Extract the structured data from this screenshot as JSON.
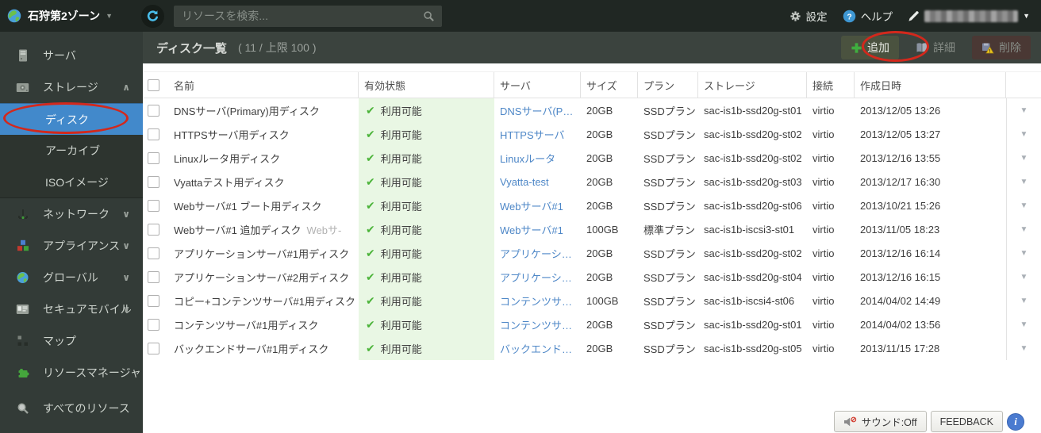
{
  "topbar": {
    "zone_label": "石狩第2ゾーン",
    "search_placeholder": "リソースを検索...",
    "settings_label": "設定",
    "help_label": "ヘルプ"
  },
  "sidebar": {
    "items": [
      {
        "id": "server",
        "label": "サーバ",
        "icon": "server-icon"
      },
      {
        "id": "storage",
        "label": "ストレージ",
        "icon": "storage-icon",
        "chevron": "up"
      },
      {
        "id": "disk",
        "label": "ディスク",
        "submenu": true,
        "selected": true
      },
      {
        "id": "archive",
        "label": "アーカイブ",
        "submenu": true
      },
      {
        "id": "iso",
        "label": "ISOイメージ",
        "submenu": true
      },
      {
        "id": "network",
        "label": "ネットワーク",
        "icon": "network-icon",
        "chevron": "down"
      },
      {
        "id": "appliance",
        "label": "アプライアンス",
        "icon": "appliance-icon",
        "chevron": "down"
      },
      {
        "id": "global",
        "label": "グローバル",
        "icon": "globe-icon",
        "chevron": "down"
      },
      {
        "id": "securemobile",
        "label": "セキュアモバイル",
        "icon": "securemobile-icon",
        "chevron": "down"
      },
      {
        "id": "map",
        "label": "マップ",
        "icon": "map-icon"
      },
      {
        "id": "resourcemanager",
        "label": "リソースマネージャ",
        "icon": "resourcemanager-icon"
      },
      {
        "id": "allresources",
        "label": "すべてのリソース",
        "icon": "allresources-icon"
      }
    ]
  },
  "content_header": {
    "title": "ディスク一覧",
    "count": "( 11 / 上限 100 )",
    "add_label": "追加",
    "detail_label": "詳細",
    "delete_label": "削除"
  },
  "table": {
    "headers": {
      "name": "名前",
      "status": "有効状態",
      "server": "サーバ",
      "size": "サイズ",
      "plan": "プラン",
      "storage": "ストレージ",
      "connection": "接続",
      "created": "作成日時"
    },
    "rows": [
      {
        "name": "DNSサーバ(Primary)用ディスク",
        "note": "",
        "status": "利用可能",
        "server": "DNSサーバ(P…",
        "size": "20GB",
        "plan": "SSDプラン",
        "storage": "sac-is1b-ssd20g-st01",
        "connection": "virtio",
        "created": "2013/12/05 13:26"
      },
      {
        "name": "HTTPSサーバ用ディスク",
        "note": "",
        "status": "利用可能",
        "server": "HTTPSサーバ",
        "size": "20GB",
        "plan": "SSDプラン",
        "storage": "sac-is1b-ssd20g-st02",
        "connection": "virtio",
        "created": "2013/12/05 13:27"
      },
      {
        "name": "Linuxルータ用ディスク",
        "note": "",
        "status": "利用可能",
        "server": "Linuxルータ",
        "size": "20GB",
        "plan": "SSDプラン",
        "storage": "sac-is1b-ssd20g-st02",
        "connection": "virtio",
        "created": "2013/12/16 13:55"
      },
      {
        "name": "Vyattaテスト用ディスク",
        "note": "",
        "status": "利用可能",
        "server": "Vyatta-test",
        "size": "20GB",
        "plan": "SSDプラン",
        "storage": "sac-is1b-ssd20g-st03",
        "connection": "virtio",
        "created": "2013/12/17 16:30"
      },
      {
        "name": "Webサーバ#1 ブート用ディスク",
        "note": "",
        "status": "利用可能",
        "server": "Webサーバ#1",
        "size": "20GB",
        "plan": "SSDプラン",
        "storage": "sac-is1b-ssd20g-st06",
        "connection": "virtio",
        "created": "2013/10/21 15:26"
      },
      {
        "name": "Webサーバ#1 追加ディスク",
        "note": "Webサ-",
        "status": "利用可能",
        "server": "Webサーバ#1",
        "size": "100GB",
        "plan": "標準プラン",
        "storage": "sac-is1b-iscsi3-st01",
        "connection": "virtio",
        "created": "2013/11/05 18:23"
      },
      {
        "name": "アプリケーションサーバ#1用ディスク",
        "note": "",
        "status": "利用可能",
        "server": "アプリケーシ…",
        "size": "20GB",
        "plan": "SSDプラン",
        "storage": "sac-is1b-ssd20g-st02",
        "connection": "virtio",
        "created": "2013/12/16 16:14"
      },
      {
        "name": "アプリケーションサーバ#2用ディスク",
        "note": "",
        "status": "利用可能",
        "server": "アプリケーシ…",
        "size": "20GB",
        "plan": "SSDプラン",
        "storage": "sac-is1b-ssd20g-st04",
        "connection": "virtio",
        "created": "2013/12/16 16:15"
      },
      {
        "name": "コピー+コンテンツサーバ#1用ディスク",
        "note": "",
        "status": "利用可能",
        "server": "コンテンツサ…",
        "size": "100GB",
        "plan": "SSDプラン",
        "storage": "sac-is1b-iscsi4-st06",
        "connection": "virtio",
        "created": "2014/04/02 14:49"
      },
      {
        "name": "コンテンツサーバ#1用ディスク",
        "note": "",
        "status": "利用可能",
        "server": "コンテンツサ…",
        "size": "20GB",
        "plan": "SSDプラン",
        "storage": "sac-is1b-ssd20g-st01",
        "connection": "virtio",
        "created": "2014/04/02 13:56"
      },
      {
        "name": "バックエンドサーバ#1用ディスク",
        "note": "",
        "status": "利用可能",
        "server": "バックエンド…",
        "size": "20GB",
        "plan": "SSDプラン",
        "storage": "sac-is1b-ssd20g-st05",
        "connection": "virtio",
        "created": "2013/11/15 17:28"
      }
    ]
  },
  "footer": {
    "sound_label": "サウンド:Off",
    "feedback_label": "FEEDBACK"
  },
  "colors": {
    "topbar_bg": "#202723",
    "sidebar_bg": "#333b37",
    "submenu_bg": "#2d342f",
    "selected_blue": "#4289cb",
    "header_bar_bg": "#3b433e",
    "status_green_bg": "#e9f7e4",
    "check_green": "#4cb43a",
    "link_blue": "#4e87c7",
    "add_plus_green": "#3fae3f",
    "annotation_red": "#d3281c",
    "delete_btn_bg": "#4a3834"
  }
}
